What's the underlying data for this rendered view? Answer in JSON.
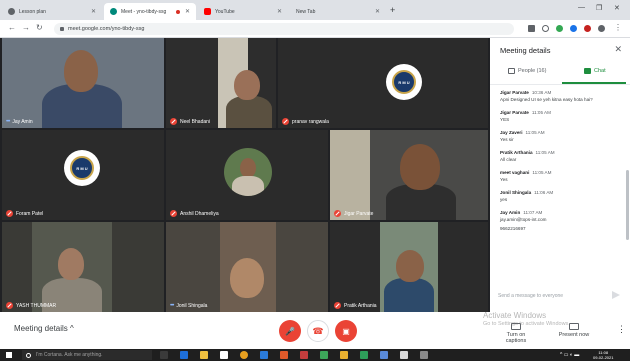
{
  "tabs": [
    {
      "label": "Lesson plan",
      "favicon": "globe-icon",
      "color": "#5f6368",
      "active": false
    },
    {
      "label": "Meet - yno-tibdy-ssg",
      "favicon": "meet-icon",
      "color": "#00897b",
      "active": true
    },
    {
      "label": "YouTube",
      "favicon": "youtube-icon",
      "color": "#ff0000",
      "active": false
    },
    {
      "label": "New Tab",
      "favicon": "",
      "color": "",
      "active": false
    }
  ],
  "address": {
    "url": "meet.google.com/yno-tibdy-ssg"
  },
  "participants": [
    {
      "name": "Jay Amin",
      "muted": false
    },
    {
      "name": "Neel Bhadani",
      "muted": true
    },
    {
      "name": "pranav rangwala",
      "muted": true
    },
    {
      "name": "Foram Patel",
      "muted": true
    },
    {
      "name": "Anshil Dhameliya",
      "muted": true
    },
    {
      "name": "Jigar Parvate",
      "muted": true
    },
    {
      "name": "YASH THUMMAR",
      "muted": true
    },
    {
      "name": "Jonil Shingala",
      "muted": false
    },
    {
      "name": "Pratik Arthania",
      "muted": true
    }
  ],
  "logo_text": "R M U",
  "panel": {
    "title": "Meeting details",
    "tab_people": "People (16)",
    "tab_chat": "Chat",
    "messages": [
      {
        "sender": "Jigar Parvate",
        "time": "10:36 AM",
        "text": "Apni Designed UI se yeh kitna easy hota hai?"
      },
      {
        "sender": "Jigar Parvate",
        "time": "11:05 AM",
        "text": "YES"
      },
      {
        "sender": "Jay Zaveri",
        "time": "11:05 AM",
        "text": "Yes sir"
      },
      {
        "sender": "Pratik Arthania",
        "time": "11:05 AM",
        "text": "All clear"
      },
      {
        "sender": "meet vaghani",
        "time": "11:05 AM",
        "text": "Yes"
      },
      {
        "sender": "Jonil Shingala",
        "time": "11:06 AM",
        "text": "yes"
      },
      {
        "sender": "Jay Amin",
        "time": "11:07 AM",
        "text": "jay.amin@tops-int.com"
      },
      {
        "sender": "",
        "time": "",
        "text": "9662216697"
      }
    ],
    "input_placeholder": "Send a message to everyone"
  },
  "bottom": {
    "details_label": "Meeting details",
    "captions_label": "Turn on captions",
    "present_label": "Present now",
    "watermark_title": "Activate Windows",
    "watermark_sub": "Go to Settings to activate Windows."
  },
  "taskbar": {
    "search_placeholder": "I'm Cortana. Ask me anything.",
    "time": "11:08",
    "date": "09-02-2021"
  },
  "colors": {
    "red": "#ea4335",
    "green": "#1e8e3e",
    "dark": "#202124"
  }
}
